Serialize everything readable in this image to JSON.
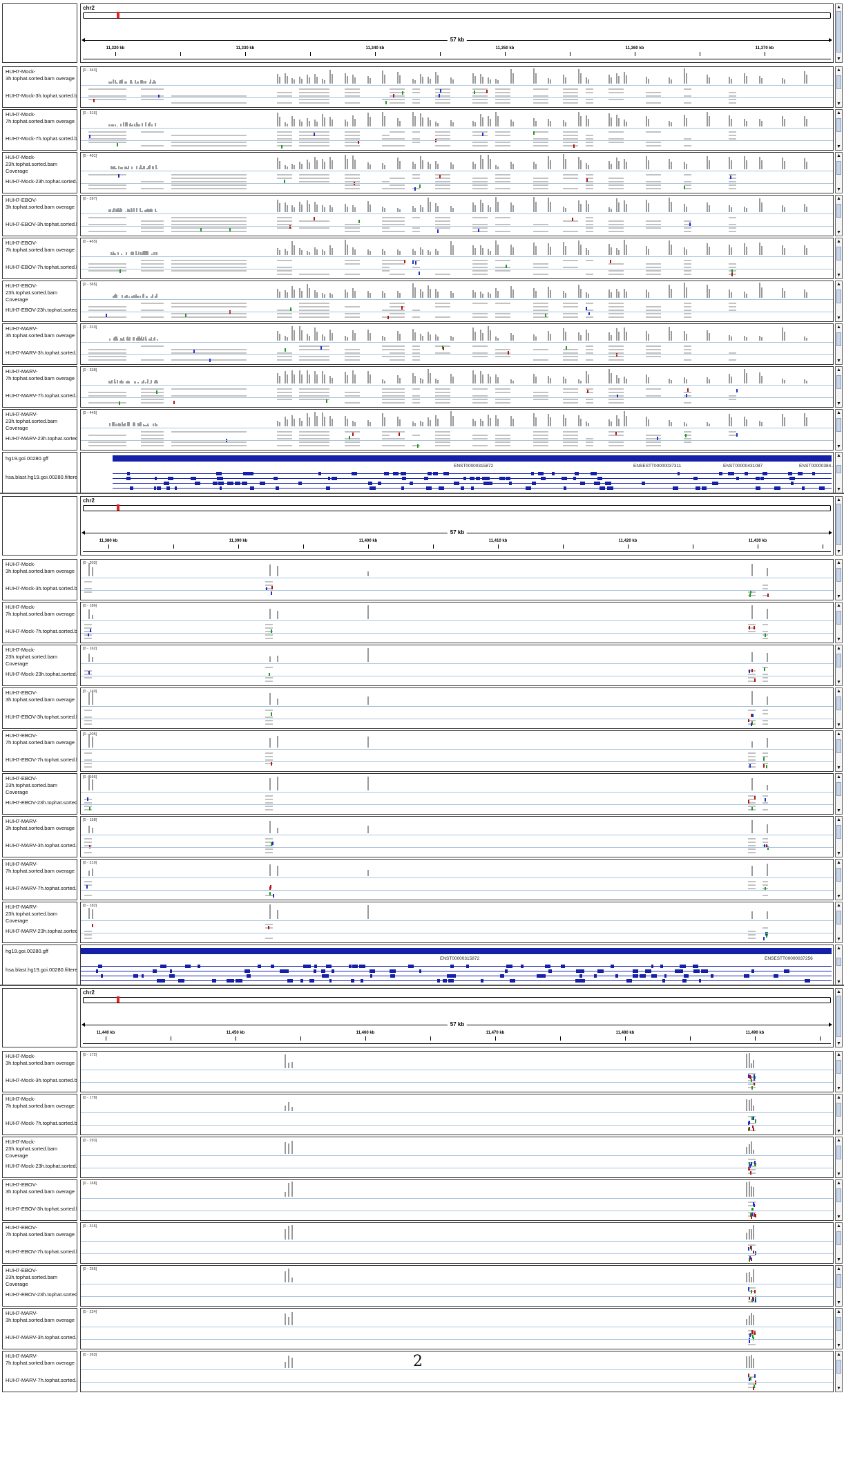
{
  "page_number": "2",
  "colors": {
    "coverage": "#9a9a9a",
    "gene": "#1420a8",
    "ideogram_mark": "#e52222",
    "read": "#c2c2c2",
    "mismatch_green": "#1e9b1e",
    "mismatch_blue": "#1f2fcf",
    "mismatch_red": "#b01616"
  },
  "panels": [
    {
      "chromosome": "chr2",
      "span": "57 kb",
      "ticks": [
        "11,320 kb",
        "11,330 kb",
        "11,340 kb",
        "11,350 kb",
        "11,360 kb",
        "11,370 kb"
      ],
      "samples": [
        {
          "coverage_label": "HUH7-Mock-3h.tophat.sorted.bam overage",
          "reads_label": "HUH7-Mock-3h.tophat.sorted.bam",
          "range": "[0 - 343]"
        },
        {
          "coverage_label": "HUH7-Mock-7h.tophat.sorted.bam overage",
          "reads_label": "HUH7-Mock-7h.tophat.sorted.bam",
          "range": "[0 - 315]"
        },
        {
          "coverage_label": "HUH7-Mock-23h.tophat.sorted.bam Coverage",
          "reads_label": "HUH7-Mock-23h.tophat.sorted.bam",
          "range": "[0 - 401]"
        },
        {
          "coverage_label": "HUH7-EBOV-3h.tophat.sorted.bam overage",
          "reads_label": "HUH7-EBOV-3h.tophat.sorted.bam",
          "range": "[0 - 297]"
        },
        {
          "coverage_label": "HUH7-EBOV-7h.tophat.sorted.bam overage",
          "reads_label": "HUH7-EBOV-7h.tophat.sorted.bam",
          "range": "[0 - 465]"
        },
        {
          "coverage_label": "HUH7-EBOV-23h.tophat.sorted.bam Coverage",
          "reads_label": "HUH7-EBOV-23h.tophat.sorted.bam",
          "range": "[0 - 365]"
        },
        {
          "coverage_label": "HUH7-MARV-3h.tophat.sorted.bam overage",
          "reads_label": "HUH7-MARV-3h.tophat.sorted.bam",
          "range": "[0 - 310]"
        },
        {
          "coverage_label": "HUH7-MARV-7h.tophat.sorted.bam overage",
          "reads_label": "HUH7-MARV-7h.tophat.sorted.bam",
          "range": "[0 - 338]"
        },
        {
          "coverage_label": "HUH7-MARV-23h.tophat.sorted.bam Coverage",
          "reads_label": "HUH7-MARV-23h.tophat.sorted.bam",
          "range": "[0 - 445]"
        }
      ],
      "gene_tracks": [
        "hg19.goi.00280.gff",
        "hsa.blast.hg19.goi.00280.filtered.gff"
      ],
      "gene_labels": [
        "ENST00000315872",
        "ENSESTT00000037311",
        "ENST00000431087",
        "ENST00000384..."
      ]
    },
    {
      "chromosome": "chr2",
      "span": "57 kb",
      "ticks": [
        "11,380 kb",
        "11,390 kb",
        "11,400 kb",
        "11,410 kb",
        "11,420 kb",
        "11,430 kb"
      ],
      "samples": [
        {
          "coverage_label": "HUH7-Mock-3h.tophat.sorted.bam overage",
          "reads_label": "HUH7-Mock-3h.tophat.sorted.bam",
          "range": "[0 - 203]"
        },
        {
          "coverage_label": "HUH7-Mock-7h.tophat.sorted.bam overage",
          "reads_label": "HUH7-Mock-7h.tophat.sorted.bam",
          "range": "[0 - 186]"
        },
        {
          "coverage_label": "HUH7-Mock-23h.tophat.sorted.bam Coverage",
          "reads_label": "HUH7-Mock-23h.tophat.sorted.bam",
          "range": "[0 - 162]"
        },
        {
          "coverage_label": "HUH7-EBOV-3h.tophat.sorted.bam overage",
          "reads_label": "HUH7-EBOV-3h.tophat.sorted.bam",
          "range": "[0 - 140]"
        },
        {
          "coverage_label": "HUH7-EBOV-7h.tophat.sorted.bam overage",
          "reads_label": "HUH7-EBOV-7h.tophat.sorted.bam",
          "range": "[0 - 205]"
        },
        {
          "coverage_label": "HUH7-EBOV-23h.tophat.sorted.bam Coverage",
          "reads_label": "HUH7-EBOV-23h.tophat.sorted.bam",
          "range": "[0 - 166]"
        },
        {
          "coverage_label": "HUH7-MARV-3h.tophat.sorted.bam overage",
          "reads_label": "HUH7-MARV-3h.tophat.sorted.bam",
          "range": "[0 - 158]"
        },
        {
          "coverage_label": "HUH7-MARV-7h.tophat.sorted.bam overage",
          "reads_label": "HUH7-MARV-7h.tophat.sorted.bam",
          "range": "[0 - 210]"
        },
        {
          "coverage_label": "HUH7-MARV-23h.tophat.sorted.bam Coverage",
          "reads_label": "HUH7-MARV-23h.tophat.sorted.bam",
          "range": "[0 - 182]"
        }
      ],
      "gene_tracks": [
        "hg19.goi.00280.gff",
        "hsa.blast.hg19.goi.00280.filtered.gff"
      ],
      "gene_labels": [
        "ENST00000315872",
        "ENSESTT00000037256"
      ]
    },
    {
      "chromosome": "chr2",
      "span": "57 kb",
      "ticks": [
        "11,440 kb",
        "11,450 kb",
        "11,460 kb",
        "11,470 kb",
        "11,480 kb",
        "11,490 kb"
      ],
      "samples": [
        {
          "coverage_label": "HUH7-Mock-3h.tophat.sorted.bam overage",
          "reads_label": "HUH7-Mock-3h.tophat.sorted.bam",
          "range": "[0 - 172]"
        },
        {
          "coverage_label": "HUH7-Mock-7h.tophat.sorted.bam overage",
          "reads_label": "HUH7-Mock-7h.tophat.sorted.bam",
          "range": "[0 - 178]"
        },
        {
          "coverage_label": "HUH7-Mock-23h.tophat.sorted.bam Coverage",
          "reads_label": "HUH7-Mock-23h.tophat.sorted.bam",
          "range": "[0 - 293]"
        },
        {
          "coverage_label": "HUH7-EBOV-3h.tophat.sorted.bam overage",
          "reads_label": "HUH7-EBOV-3h.tophat.sorted.bam",
          "range": "[0 - 168]"
        },
        {
          "coverage_label": "HUH7-EBOV-7h.tophat.sorted.bam overage",
          "reads_label": "HUH7-EBOV-7h.tophat.sorted.bam",
          "range": "[0 - 316]"
        },
        {
          "coverage_label": "HUH7-EBOV-23h.tophat.sorted.bam Coverage",
          "reads_label": "HUH7-EBOV-23h.tophat.sorted.bam",
          "range": "[0 - 255]"
        },
        {
          "coverage_label": "HUH7-MARV-3h.tophat.sorted.bam overage",
          "reads_label": "HUH7-MARV-3h.tophat.sorted.bam",
          "range": "[0 - 224]"
        },
        {
          "coverage_label": "HUH7-MARV-7h.tophat.sorted.bam overage",
          "reads_label": "HUH7-MARV-7h.tophat.sorted.bam",
          "range": "[0 - 263]"
        }
      ],
      "gene_tracks": [],
      "gene_labels": []
    }
  ]
}
